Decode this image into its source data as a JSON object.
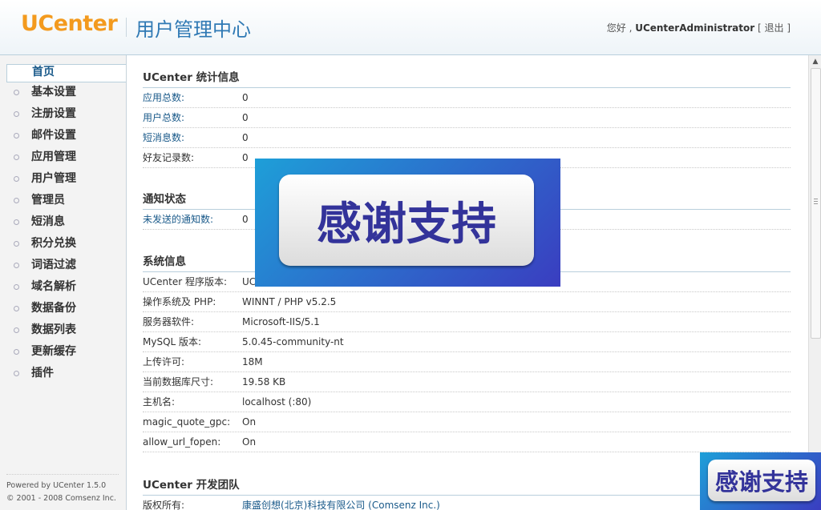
{
  "header": {
    "logo": "UCenter",
    "title": "用户管理中心",
    "greeting": "您好 , ",
    "username": "UCenterAdministrator",
    "logout_open": " [ ",
    "logout_label": "退出",
    "logout_close": " ]"
  },
  "sidebar": {
    "items": [
      {
        "label": "首页"
      },
      {
        "label": "基本设置"
      },
      {
        "label": "注册设置"
      },
      {
        "label": "邮件设置"
      },
      {
        "label": "应用管理"
      },
      {
        "label": "用户管理"
      },
      {
        "label": "管理员"
      },
      {
        "label": "短消息"
      },
      {
        "label": "积分兑换"
      },
      {
        "label": "词语过滤"
      },
      {
        "label": "域名解析"
      },
      {
        "label": "数据备份"
      },
      {
        "label": "数据列表"
      },
      {
        "label": "更新缓存"
      },
      {
        "label": "插件"
      }
    ],
    "footer_line1": "Powered by UCenter 1.5.0",
    "footer_line2": "© 2001 - 2008 Comsenz Inc."
  },
  "stats": {
    "title": "UCenter 统计信息",
    "rows": [
      {
        "key": "应用总数:",
        "value": "0"
      },
      {
        "key": "用户总数:",
        "value": "0"
      },
      {
        "key": "短消息数:",
        "value": "0"
      },
      {
        "key": "好友记录数:",
        "value": "0"
      }
    ]
  },
  "notice": {
    "title": "通知状态",
    "rows": [
      {
        "key": "未发送的通知数:",
        "value": "0"
      }
    ]
  },
  "system": {
    "title": "系统信息",
    "rows": [
      {
        "key": "UCenter 程序版本:",
        "value": "UCenter 1.5.0 Release 20081212 查看最新版本"
      },
      {
        "key": "操作系统及 PHP:",
        "value": "WINNT / PHP v5.2.5"
      },
      {
        "key": "服务器软件:",
        "value": "Microsoft-IIS/5.1"
      },
      {
        "key": "MySQL 版本:",
        "value": "5.0.45-community-nt"
      },
      {
        "key": "上传许可:",
        "value": "18M"
      },
      {
        "key": "当前数据库尺寸:",
        "value": "19.58 KB"
      },
      {
        "key": "主机名:",
        "value": "localhost (:80)"
      },
      {
        "key": "magic_quote_gpc:",
        "value": "On"
      },
      {
        "key": "allow_url_fopen:",
        "value": "On"
      }
    ]
  },
  "team": {
    "title": "UCenter 开发团队",
    "rows": [
      {
        "key": "版权所有:",
        "value": "康盛创想(北京)科技有限公司 (Comsenz Inc.)"
      }
    ]
  },
  "overlay": {
    "text": "感谢支持"
  },
  "colors": {
    "logo": "#f39a1e",
    "title": "#2f79b4",
    "link": "#1a5a8a",
    "badge_text": "#33339a"
  }
}
